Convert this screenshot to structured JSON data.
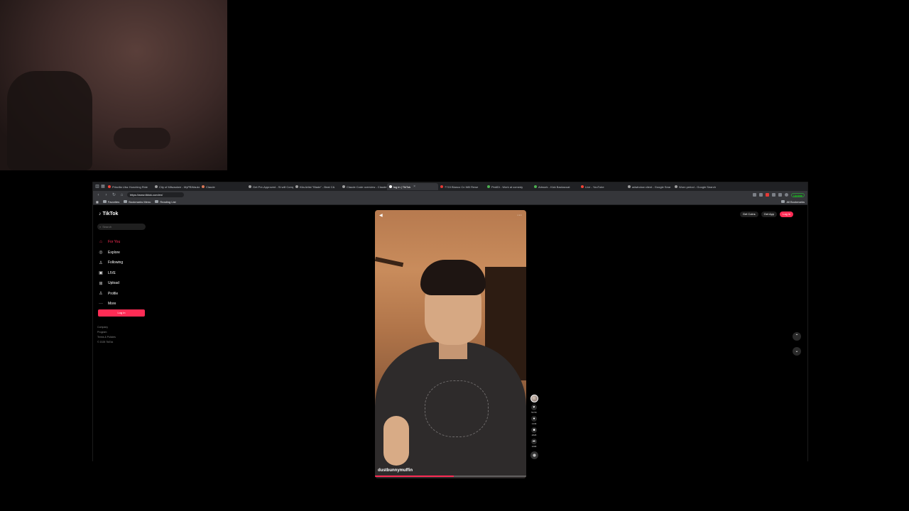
{
  "browser": {
    "tabs": [
      {
        "title": "Priscilla Ulsz Hunching Ride",
        "color": "#f44336"
      },
      {
        "title": "City of Milwaukee - MyPBWaukee",
        "color": "#9e9e9e"
      },
      {
        "title": "Claude",
        "color": "#d97757"
      },
      {
        "title": "Get Pre-Approved - St will Comp",
        "color": "#9e9e9e"
      },
      {
        "title": "Kila Artist \"Blade\" - Beat C&",
        "color": "#9e9e9e"
      },
      {
        "title": "Claude Code overview - Claude",
        "color": "#9e9e9e"
      },
      {
        "title": "log in | TikTok",
        "color": "#ffffff",
        "active": true
      },
      {
        "title": "7715 Blanco Cn Will Rewe",
        "color": "#e53935"
      },
      {
        "title": "PediDi - Work at comedy",
        "color": "#4caf50"
      },
      {
        "title": "Artwork - Kick Backacoat",
        "color": "#4caf50"
      },
      {
        "title": "Live - YouTube",
        "color": "#f44336"
      },
      {
        "title": "adwindow client - Google Sear",
        "color": "#9e9e9e"
      },
      {
        "title": "Worn period - Google Search",
        "color": "#9e9e9e"
      }
    ],
    "url": "https://www.tiktok.com/en/",
    "update_label": "Update",
    "bookmarks": [
      "Favorites",
      "Bookmarks Menu",
      "Reading List"
    ],
    "all_bookmarks": "All Bookmarks"
  },
  "tiktok": {
    "logo": "TikTok",
    "search_placeholder": "Search",
    "menu": [
      {
        "icon": "home-icon",
        "glyph": "⌂",
        "label": "For You",
        "active": true
      },
      {
        "icon": "compass-icon",
        "glyph": "◎",
        "label": "Explore"
      },
      {
        "icon": "users-icon",
        "glyph": "♙",
        "label": "Following"
      },
      {
        "icon": "live-icon",
        "glyph": "▣",
        "label": "LIVE"
      },
      {
        "icon": "upload-icon",
        "glyph": "⊞",
        "label": "Upload"
      },
      {
        "icon": "profile-icon",
        "glyph": "♙",
        "label": "Profile"
      },
      {
        "icon": "more-icon",
        "glyph": "···",
        "label": "More"
      }
    ],
    "login_button": "Log in",
    "footer": [
      "Company",
      "Program",
      "Terms & Policies",
      "© 2025 TikTok"
    ],
    "get_coins": "Get Coins",
    "get_app": "Get App",
    "login_top": "Log in",
    "video": {
      "username": "dustbunnymuffin",
      "progress": 0.52
    },
    "actions": [
      {
        "icon": "heart-icon",
        "glyph": "♥",
        "count": "53.5K"
      },
      {
        "icon": "comment-icon",
        "glyph": "●",
        "count": "1449"
      },
      {
        "icon": "bookmark-icon",
        "glyph": "■",
        "count": "4828"
      },
      {
        "icon": "share-icon",
        "glyph": "➦",
        "count": "1068"
      }
    ]
  }
}
